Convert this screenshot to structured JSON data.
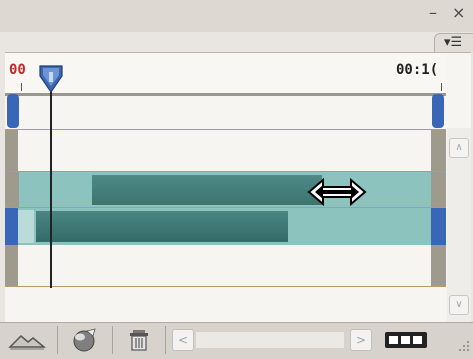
{
  "window": {
    "minimize_glyph": "–",
    "close_glyph": "×"
  },
  "panel_menu": {
    "glyph": "▾☰"
  },
  "ruler": {
    "start_label": "00",
    "end_label": "00:1("
  },
  "timeline": {
    "playhead_icon": "playhead-marker-icon",
    "resize_cursor_icon": "horizontal-resize-cursor-icon"
  },
  "colors": {
    "clip_light": "#8cc3bf",
    "clip_dark": "#3f7b78",
    "clip_handle": "#3a66b7",
    "playhead": "#2f5fa5",
    "start_label": "#c0282c",
    "ruler_line": "#b89b6d"
  },
  "bottom_bar": {
    "buttons": [
      {
        "name": "zoom-mountain-icon"
      },
      {
        "name": "render-sphere-icon"
      },
      {
        "name": "trash-icon"
      }
    ],
    "scroll_left_glyph": "<",
    "scroll_right_glyph": ">",
    "frames_icon": "film-frames-icon"
  },
  "scrollbar": {
    "up_glyph": "∧",
    "down_glyph": "∨"
  }
}
